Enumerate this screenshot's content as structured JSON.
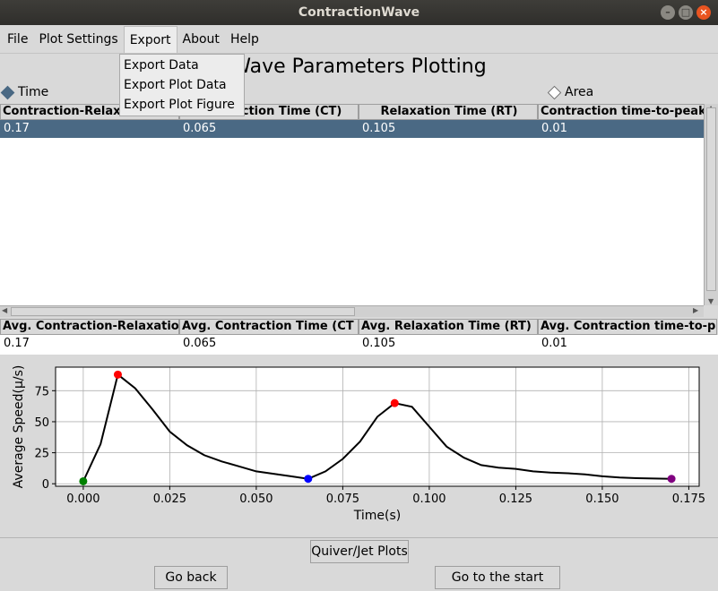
{
  "window": {
    "title": "ContractionWave"
  },
  "menu": {
    "items": [
      "File",
      "Plot Settings",
      "Export",
      "About",
      "Help"
    ],
    "export_dropdown": [
      "Export Data",
      "Export Plot Data",
      "Export Plot Figure"
    ]
  },
  "page": {
    "title": "Wave Parameters Plotting"
  },
  "radios": {
    "time": "Time",
    "area": "Area"
  },
  "table": {
    "columns": [
      "Contraction-Relaxation Ti",
      "Contraction Time (CT)",
      "Relaxation Time (RT)",
      "Contraction time-to-peak"
    ],
    "rows": [
      [
        "0.17",
        "0.065",
        "0.105",
        "0.01"
      ]
    ]
  },
  "avg_table": {
    "columns": [
      "Avg. Contraction-Relaxatio",
      "Avg. Contraction Time (CT",
      "Avg. Relaxation Time (RT)",
      "Avg. Contraction time-to-p"
    ],
    "rows": [
      [
        "0.17",
        "0.065",
        "0.105",
        "0.01"
      ]
    ]
  },
  "buttons": {
    "quiver": "Quiver/Jet Plots",
    "back": "Go back",
    "start": "Go to the start page"
  },
  "colors": {
    "selection": "#4a6984",
    "accent": "#e95420"
  },
  "chart_data": {
    "type": "line",
    "xlabel": "Time(s)",
    "ylabel": "Average Speed(μ/s)",
    "xlim": [
      -0.008,
      0.178
    ],
    "ylim": [
      -2,
      94
    ],
    "xticks": [
      0.0,
      0.025,
      0.05,
      0.075,
      0.1,
      0.125,
      0.15,
      0.175
    ],
    "xtick_labels": [
      "0.000",
      "0.025",
      "0.050",
      "0.075",
      "0.100",
      "0.125",
      "0.150",
      "0.175"
    ],
    "yticks": [
      0,
      25,
      50,
      75
    ],
    "grid": true,
    "x": [
      0.0,
      0.005,
      0.01,
      0.015,
      0.02,
      0.025,
      0.03,
      0.035,
      0.04,
      0.045,
      0.05,
      0.055,
      0.06,
      0.065,
      0.07,
      0.075,
      0.08,
      0.085,
      0.09,
      0.095,
      0.1,
      0.105,
      0.11,
      0.115,
      0.12,
      0.125,
      0.13,
      0.135,
      0.14,
      0.145,
      0.15,
      0.155,
      0.16,
      0.165,
      0.17
    ],
    "y": [
      2,
      32,
      88,
      77,
      60,
      42,
      31,
      23,
      18,
      14,
      10,
      8,
      6,
      4,
      10,
      20,
      34,
      54,
      65,
      62,
      46,
      30,
      21,
      15,
      13,
      12,
      10,
      9,
      8.5,
      7.5,
      6,
      5,
      4.5,
      4.2,
      4
    ],
    "markers": [
      {
        "x": 0.0,
        "y": 2,
        "color": "#008000"
      },
      {
        "x": 0.01,
        "y": 88,
        "color": "#ff0000"
      },
      {
        "x": 0.065,
        "y": 4,
        "color": "#0000ff"
      },
      {
        "x": 0.09,
        "y": 65,
        "color": "#ff0000"
      },
      {
        "x": 0.17,
        "y": 4,
        "color": "#800080"
      }
    ]
  }
}
